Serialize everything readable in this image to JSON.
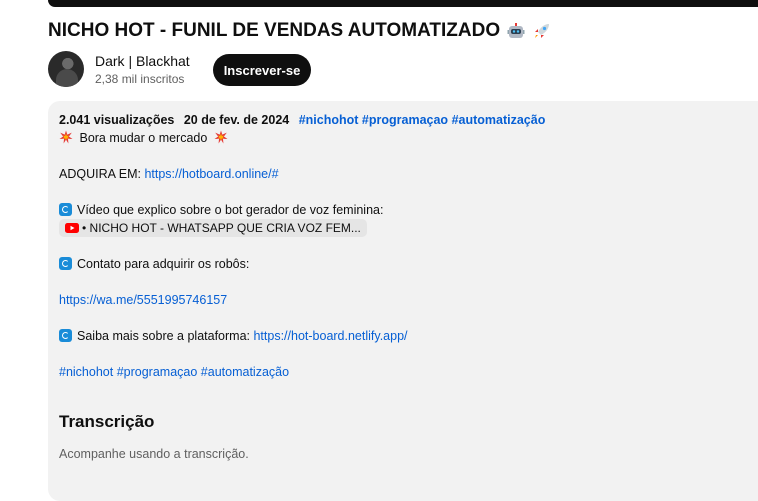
{
  "video": {
    "title": "NICHO HOT - FUNIL DE VENDAS AUTOMATIZADO",
    "title_emojis": [
      "robot-emoji",
      "rocket-emoji"
    ]
  },
  "channel": {
    "name": "Dark | Blackhat",
    "subscribers": "2,38 mil inscritos",
    "subscribe_label": "Inscrever-se"
  },
  "description": {
    "views": "2.041 visualizações",
    "date": "20 de fev. de 2024",
    "meta_tags": [
      "#nichohot",
      "#programaçao",
      "#automatização"
    ],
    "line_bora": "Bora mudar o mercado",
    "adquira_label": "ADQUIRA EM: ",
    "adquira_link": "https://hotboard.online/#",
    "video_line": "Vídeo que explico sobre o bot gerador de voz feminina:",
    "chip_text": "• NICHO HOT - WHATSAPP QUE CRIA VOZ FEM...",
    "contato_line": "Contato para adquirir os robôs:",
    "wa_link": "https://wa.me/5551995746157",
    "saiba_label": "Saiba mais sobre a plataforma: ",
    "saiba_link": "https://hot-board.netlify.app/",
    "footer_tags": [
      "#nichohot",
      "#programaçao",
      "#automatização"
    ]
  },
  "transcript": {
    "heading": "Transcrição",
    "subtitle": "Acompanhe usando a transcrição."
  },
  "colors": {
    "link": "#065fd4",
    "description_bg": "#f2f2f2",
    "subscribe_bg": "#0f0f0f"
  }
}
